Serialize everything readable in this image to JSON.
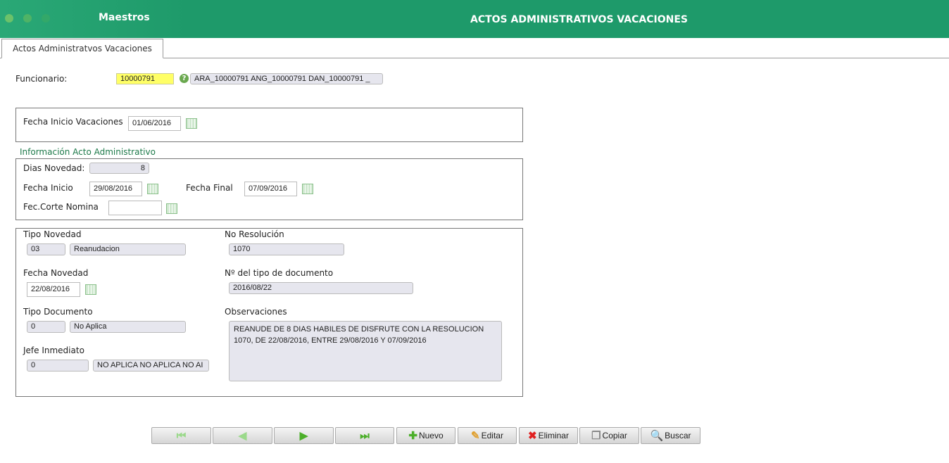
{
  "header": {
    "app": "Maestros",
    "title": "ACTOS ADMINISTRATIVOS VACACIONES"
  },
  "tab": "Actos Administratvos Vacaciones",
  "funcionario": {
    "label": "Funcionario:",
    "code": "10000791",
    "name": "ARA_10000791 ANG_10000791 DAN_10000791 _"
  },
  "fecha_inicio_vac": {
    "label": "Fecha Inicio Vacaciones",
    "value": "01/06/2016"
  },
  "info": {
    "title": "Información Acto Administrativo",
    "dias_label": "Dias Novedad:",
    "dias": "8",
    "fi_label": "Fecha Inicio",
    "fi": "29/08/2016",
    "ff_label": "Fecha Final",
    "ff": "07/09/2016",
    "corte_label": "Fec.Corte Nomina",
    "corte": ""
  },
  "detalle": {
    "tipo_novedad_label": "Tipo Novedad",
    "tipo_novedad_code": "03",
    "tipo_novedad": "Reanudacion",
    "resolucion_label": "No Resolución",
    "resolucion": "1070",
    "fecha_novedad_label": "Fecha Novedad",
    "fecha_novedad": "22/08/2016",
    "num_doc_label": "Nº del tipo de documento",
    "num_doc": "2016/08/22",
    "tipo_doc_label": "Tipo Documento",
    "tipo_doc_code": "0",
    "tipo_doc": "No Aplica",
    "obs_label": "Observaciones",
    "obs": "REANUDE DE 8 DIAS HABILES DE DISFRUTE CON LA RESOLUCION 1070, DE 22/08/2016, ENTRE 29/08/2016 Y 07/09/2016",
    "jefe_label": "Jefe Inmediato",
    "jefe_code": "0",
    "jefe": "NO APLICA NO APLICA NO AI"
  },
  "toolbar": {
    "nuevo": "Nuevo",
    "editar": "Editar",
    "eliminar": "Eliminar",
    "copiar": "Copiar",
    "buscar": "Buscar"
  },
  "colors": {
    "header": "#1e9a6a",
    "highlight": "#ffff66"
  }
}
